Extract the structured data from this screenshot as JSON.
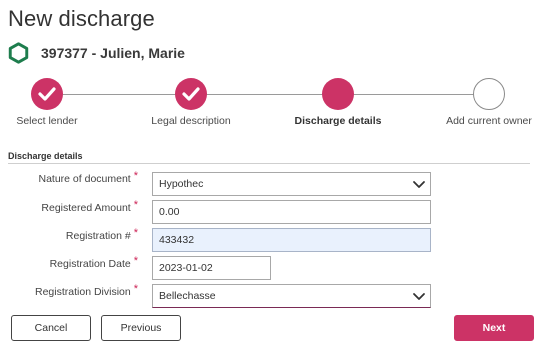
{
  "page": {
    "title": "New discharge"
  },
  "file": {
    "label": "397377 - Julien, Marie",
    "icon": "hexagon-icon",
    "icon_color": "#1e7d4d"
  },
  "stepper": {
    "accent": "#cc3366",
    "steps": [
      {
        "label": "Select lender",
        "state": "completed"
      },
      {
        "label": "Legal description",
        "state": "completed"
      },
      {
        "label": "Discharge details",
        "state": "active"
      },
      {
        "label": "Add current owner",
        "state": "upcoming"
      }
    ]
  },
  "section": {
    "title": "Discharge details"
  },
  "form": {
    "nature": {
      "label": "Nature of document",
      "value": "Hypothec"
    },
    "amount": {
      "label": "Registered Amount",
      "value": "0.00"
    },
    "registration_number": {
      "label": "Registration #",
      "value": "433432"
    },
    "registration_date": {
      "label": "Registration Date",
      "value": "2023-01-02"
    },
    "division": {
      "label": "Registration Division",
      "value": "Bellechasse"
    },
    "required_marker": "*"
  },
  "actions": {
    "cancel": "Cancel",
    "previous": "Previous",
    "next": "Next"
  }
}
